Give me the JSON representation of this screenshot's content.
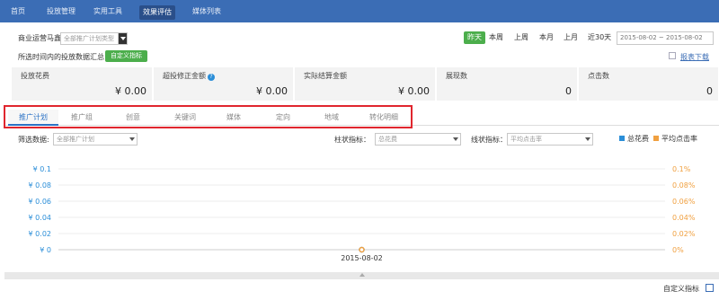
{
  "nav": {
    "items": [
      {
        "label": "首页"
      },
      {
        "label": "投放管理"
      },
      {
        "label": "实用工具"
      },
      {
        "label": "效果评估"
      },
      {
        "label": "媒体列表"
      }
    ],
    "active_index": 3
  },
  "filters": {
    "campaign_label": "商业运营马鑫",
    "campaign_type_placeholder": "全部推广计划类型",
    "ranges": [
      "昨天",
      "本周",
      "上周",
      "本月",
      "上月",
      "近30天"
    ],
    "active_range": "昨天",
    "date_range": "2015-08-02 ~ 2015-08-02"
  },
  "summary": {
    "caption": "所选时间内的投放数据汇总",
    "custom_metric_button": "自定义指标",
    "report_download": "报表下载"
  },
  "cards": [
    {
      "title": "投放花费",
      "value": "¥ 0.00"
    },
    {
      "title": "超投修正金额",
      "value": "¥ 0.00",
      "info": "?"
    },
    {
      "title": "实际结算金额",
      "value": "¥ 0.00"
    },
    {
      "title": "展现数",
      "value": "0"
    },
    {
      "title": "点击数",
      "value": "0"
    }
  ],
  "tabs": [
    "推广计划",
    "推广组",
    "创意",
    "关键词",
    "媒体",
    "定向",
    "地域",
    "转化明细"
  ],
  "active_tab": 0,
  "chart_controls": {
    "filter_label": "筛选数据:",
    "filter_value": "全部推广计划",
    "bar_metric_label": "柱状指标：",
    "bar_metric_value": "总花费",
    "line_metric_label": "线状指标：",
    "line_metric_value": "平均点击率",
    "legend": [
      {
        "name": "总花费",
        "color": "#2b8ed8"
      },
      {
        "name": "平均点击率",
        "color": "#f0a040"
      }
    ]
  },
  "chart_data": {
    "type": "line",
    "x": [
      "2015-08-02"
    ],
    "series": [
      {
        "name": "总花费",
        "values": [
          0
        ],
        "axis": "left",
        "color": "#2b8ed8"
      },
      {
        "name": "平均点击率",
        "values": [
          0
        ],
        "axis": "right",
        "color": "#f0a040"
      }
    ],
    "left_ticks": [
      "¥ 0",
      "¥ 0.02",
      "¥ 0.04",
      "¥ 0.06",
      "¥ 0.08",
      "¥ 0.1"
    ],
    "right_ticks": [
      "0%",
      "0.02%",
      "0.04%",
      "0.06%",
      "0.08%",
      "0.1%"
    ],
    "ylim_left": [
      0,
      0.1
    ],
    "ylim_right": [
      0,
      0.1
    ],
    "grid": true
  },
  "footer": {
    "custom_metric": "自定义指标"
  }
}
